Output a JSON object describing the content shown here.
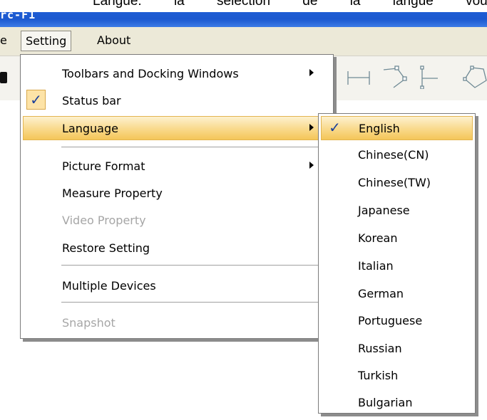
{
  "caption": {
    "text": "Langue:  la  sélection  de  la  langue  vous  perm"
  },
  "window": {
    "title": "rc-F1"
  },
  "menubar": {
    "items": [
      {
        "label": "e"
      },
      {
        "label": "Setting"
      },
      {
        "label": "About"
      }
    ]
  },
  "setting_menu": {
    "items": [
      {
        "label": "Toolbars and Docking Windows",
        "submenu": true
      },
      {
        "label": "Status bar",
        "checked": true
      },
      {
        "label": "Language",
        "submenu": true,
        "highlighted": true
      },
      {
        "label": "Picture Format",
        "submenu": true
      },
      {
        "label": "Measure Property"
      },
      {
        "label": "Video Property",
        "disabled": true
      },
      {
        "label": "Restore Setting"
      },
      {
        "label": "Multiple Devices"
      },
      {
        "label": "Snapshot",
        "disabled": true
      }
    ]
  },
  "language_menu": {
    "selected": "English",
    "items": [
      {
        "label": "English"
      },
      {
        "label": "Chinese(CN)"
      },
      {
        "label": "Chinese(TW)"
      },
      {
        "label": "Japanese"
      },
      {
        "label": "Korean"
      },
      {
        "label": "Italian"
      },
      {
        "label": "German"
      },
      {
        "label": "Portuguese"
      },
      {
        "label": "Russian"
      },
      {
        "label": "Turkish"
      },
      {
        "label": "Bulgarian"
      }
    ]
  },
  "colors": {
    "titlebar": "#1f5fd6",
    "menu_highlight": "#f9d98a",
    "checkmark": "#1b3f9a",
    "disabled_text": "#a6a6a6"
  }
}
